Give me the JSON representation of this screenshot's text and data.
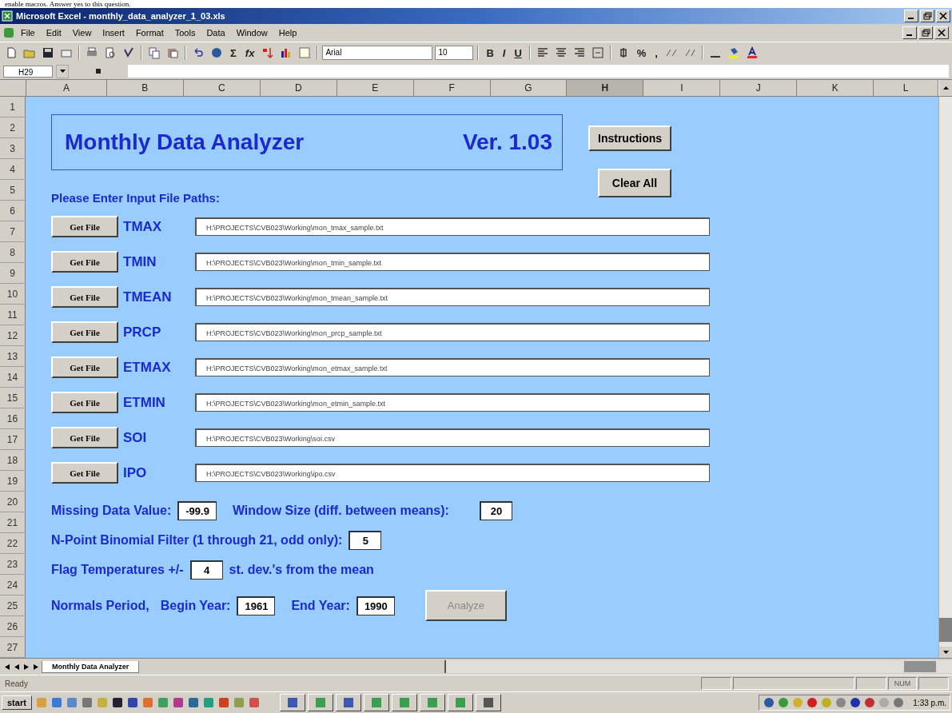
{
  "caption": "enable macros. Answer yes to this question.",
  "window": {
    "title": "Microsoft Excel - monthly_data_analyzer_1_03.xls"
  },
  "menu": [
    "File",
    "Edit",
    "View",
    "Insert",
    "Format",
    "Tools",
    "Data",
    "Window",
    "Help"
  ],
  "toolbar": {
    "autosum": "Σ",
    "function": "fx",
    "font": "Arial",
    "size": "10",
    "format_buttons": [
      "B",
      "I",
      "U"
    ],
    "number_buttons": [
      "%",
      ","
    ]
  },
  "name_box": "H29",
  "columns": [
    {
      "label": "A",
      "selected": false
    },
    {
      "label": "B",
      "selected": false
    },
    {
      "label": "C",
      "selected": false
    },
    {
      "label": "D",
      "selected": false
    },
    {
      "label": "E",
      "selected": false
    },
    {
      "label": "F",
      "selected": false
    },
    {
      "label": "G",
      "selected": false
    },
    {
      "label": "H",
      "selected": true
    },
    {
      "label": "I",
      "selected": false
    },
    {
      "label": "J",
      "selected": false
    },
    {
      "label": "K",
      "selected": false
    },
    {
      "label": "L",
      "selected": false
    }
  ],
  "rows": [
    "1",
    "2",
    "3",
    "4",
    "5",
    "6",
    "7",
    "8",
    "9",
    "10",
    "11",
    "12",
    "13",
    "14",
    "15",
    "16",
    "17",
    "18",
    "19",
    "20",
    "21",
    "22",
    "23",
    "24",
    "25",
    "26",
    "27"
  ],
  "form": {
    "title": "Monthly Data Analyzer",
    "version": "Ver. 1.03",
    "instructions_button": "Instructions",
    "clear_button": "Clear All",
    "prompt": "Please Enter Input File Paths:",
    "files": [
      {
        "button": "Get File",
        "label": "TMAX",
        "path": "H:\\PROJECTS\\CVB023\\Working\\mon_tmax_sample.txt"
      },
      {
        "button": "Get File",
        "label": "TMIN",
        "path": "H:\\PROJECTS\\CVB023\\Working\\mon_tmin_sample.txt"
      },
      {
        "button": "Get File",
        "label": "TMEAN",
        "path": "H:\\PROJECTS\\CVB023\\Working\\mon_tmean_sample.txt"
      },
      {
        "button": "Get File",
        "label": "PRCP",
        "path": "H:\\PROJECTS\\CVB023\\Working\\mon_prcp_sample.txt"
      },
      {
        "button": "Get File",
        "label": "ETMAX",
        "path": "H:\\PROJECTS\\CVB023\\Working\\mon_etmax_sample.txt"
      },
      {
        "button": "Get File",
        "label": "ETMIN",
        "path": "H:\\PROJECTS\\CVB023\\Working\\mon_etmin_sample.txt"
      },
      {
        "button": "Get File",
        "label": "SOI",
        "path": "H:\\PROJECTS\\CVB023\\Working\\soi.csv"
      },
      {
        "button": "Get File",
        "label": "IPO",
        "path": "H:\\PROJECTS\\CVB023\\Working\\ipo.csv"
      }
    ],
    "missing_label": "Missing Data Value:",
    "missing_value": "-99.9",
    "window_label": "Window Size (diff. between means):",
    "window_value": "20",
    "filter_label": "N-Point Binomial Filter (1 through 21, odd only):",
    "filter_value": "5",
    "flag_label": "Flag Temperatures +/-",
    "flag_value": "4",
    "flag_suffix": "st. dev.'s from the mean",
    "normals_label": "Normals Period,",
    "begin_label": "Begin Year:",
    "begin_value": "1961",
    "end_label": "End Year:",
    "end_value": "1990",
    "analyze_button": {
      "label": "Analyze",
      "disabled": true
    }
  },
  "sheet_tabs": [
    {
      "label": "Monthly Data Analyzer",
      "selected": true
    }
  ],
  "status": {
    "text": "Ready",
    "indicator": "NUM"
  },
  "taskbar": {
    "start": "start",
    "clock": "1:33 p.m."
  }
}
